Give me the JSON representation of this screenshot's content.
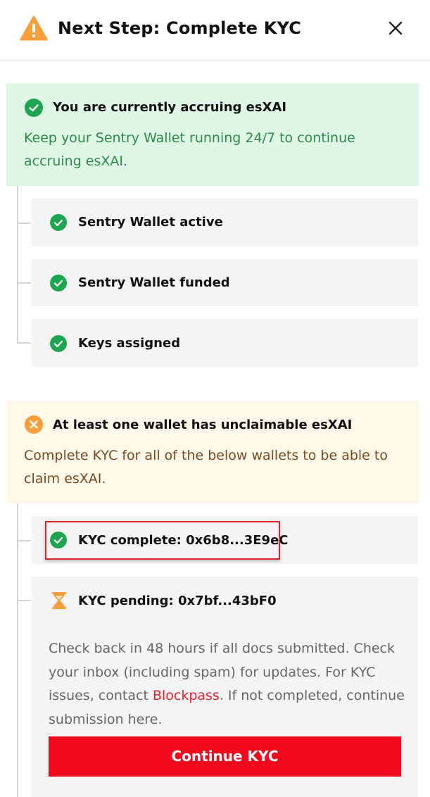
{
  "header": {
    "icon": "warning-triangle-icon",
    "title": "Next Step: Complete KYC",
    "close_icon": "close-icon"
  },
  "accruing_banner": {
    "icon": "check-circle-icon",
    "title": "You are currently accruing esXAI",
    "text": "Keep your Sentry Wallet running 24/7 to continue accruing esXAI."
  },
  "steps": [
    {
      "icon": "check-circle-icon",
      "label": "Sentry Wallet active"
    },
    {
      "icon": "check-circle-icon",
      "label": "Sentry Wallet funded"
    },
    {
      "icon": "check-circle-icon",
      "label": "Keys assigned"
    }
  ],
  "unclaimable_banner": {
    "icon": "x-circle-icon",
    "title": "At least one wallet has unclaimable esXAI",
    "text": "Complete KYC for all of the below wallets to be able to claim esXAI."
  },
  "kyc_wallets": [
    {
      "icon": "check-circle-icon",
      "label": "KYC complete: 0x6b8...3E9eC"
    },
    {
      "icon": "hourglass-icon",
      "label": "KYC pending: 0x7bf...43bF0",
      "text_before": "Check back in 48 hours if all docs submitted. Check your inbox (including spam) for updates. For KYC issues, contact ",
      "link": "Blockpass",
      "text_after": ". If not completed, continue submission here.",
      "button": "Continue KYC"
    }
  ],
  "colors": {
    "success": "#1fa552",
    "warning": "#f7a03b",
    "accent_red": "#f3091d",
    "highlight_border": "#d9252b"
  }
}
